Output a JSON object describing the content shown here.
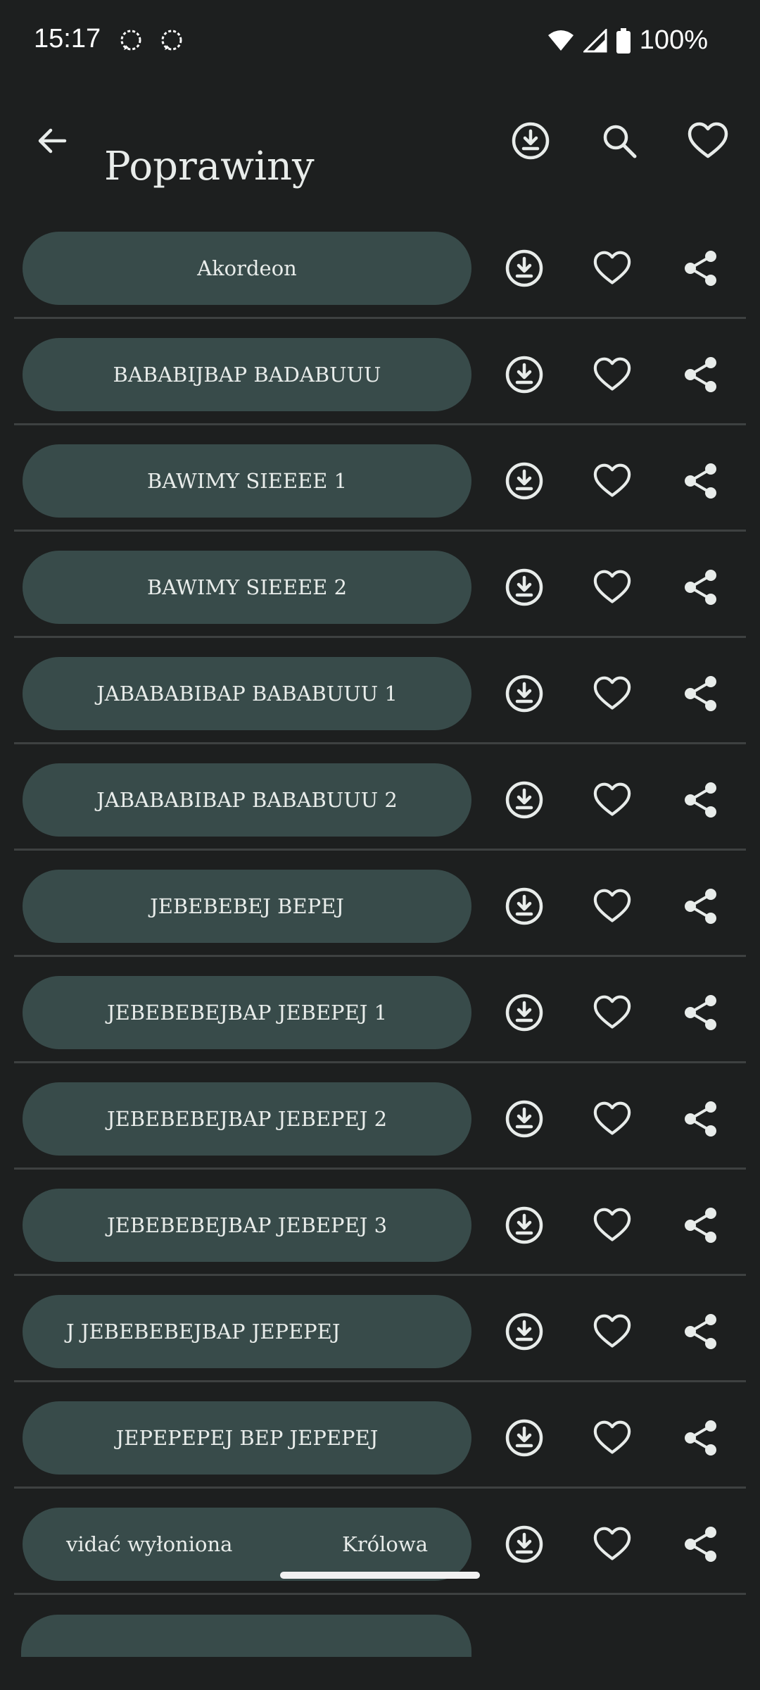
{
  "status_bar": {
    "time": "15:17",
    "battery": "100%",
    "icons": [
      "signal-messenger-icon",
      "signal-messenger-icon",
      "wifi-icon",
      "cell-signal-icon",
      "battery-icon"
    ]
  },
  "app_bar": {
    "title": "Poprawiny",
    "icons": [
      "back-arrow-icon",
      "download-icon",
      "search-icon",
      "heart-icon"
    ]
  },
  "items": [
    {
      "label": "Akordeon"
    },
    {
      "label": "BABABIJBAP BADABUUU"
    },
    {
      "label": "BAWIMY SIEEEE 1"
    },
    {
      "label": "BAWIMY SIEEEE 2"
    },
    {
      "label": "JABABABIBAP BABABUUU 1"
    },
    {
      "label": "JABABABIBAP BABABUUU 2"
    },
    {
      "label": "JEBEBEBEJ BEPEJ"
    },
    {
      "label": "JEBEBEBEJBAP JEBEPEJ 1"
    },
    {
      "label": "JEBEBEBEJBAP JEBEPEJ 2"
    },
    {
      "label": "JEBEBEBEJBAP JEBEPEJ 3"
    },
    {
      "label": "J JEBEBEBEJBAP JEPEPEJ"
    },
    {
      "label": "JEPEPEPEJ BEP JEPEPEJ"
    },
    {
      "label_a": "vidać wyłoniona",
      "label_b": "Królowa"
    }
  ],
  "row_actions": [
    "download-icon",
    "heart-icon",
    "share-icon"
  ],
  "colors": {
    "background": "#1d1f1f",
    "pill": "#384b4a",
    "divider": "#3e4141",
    "text": "#e8ecea"
  }
}
